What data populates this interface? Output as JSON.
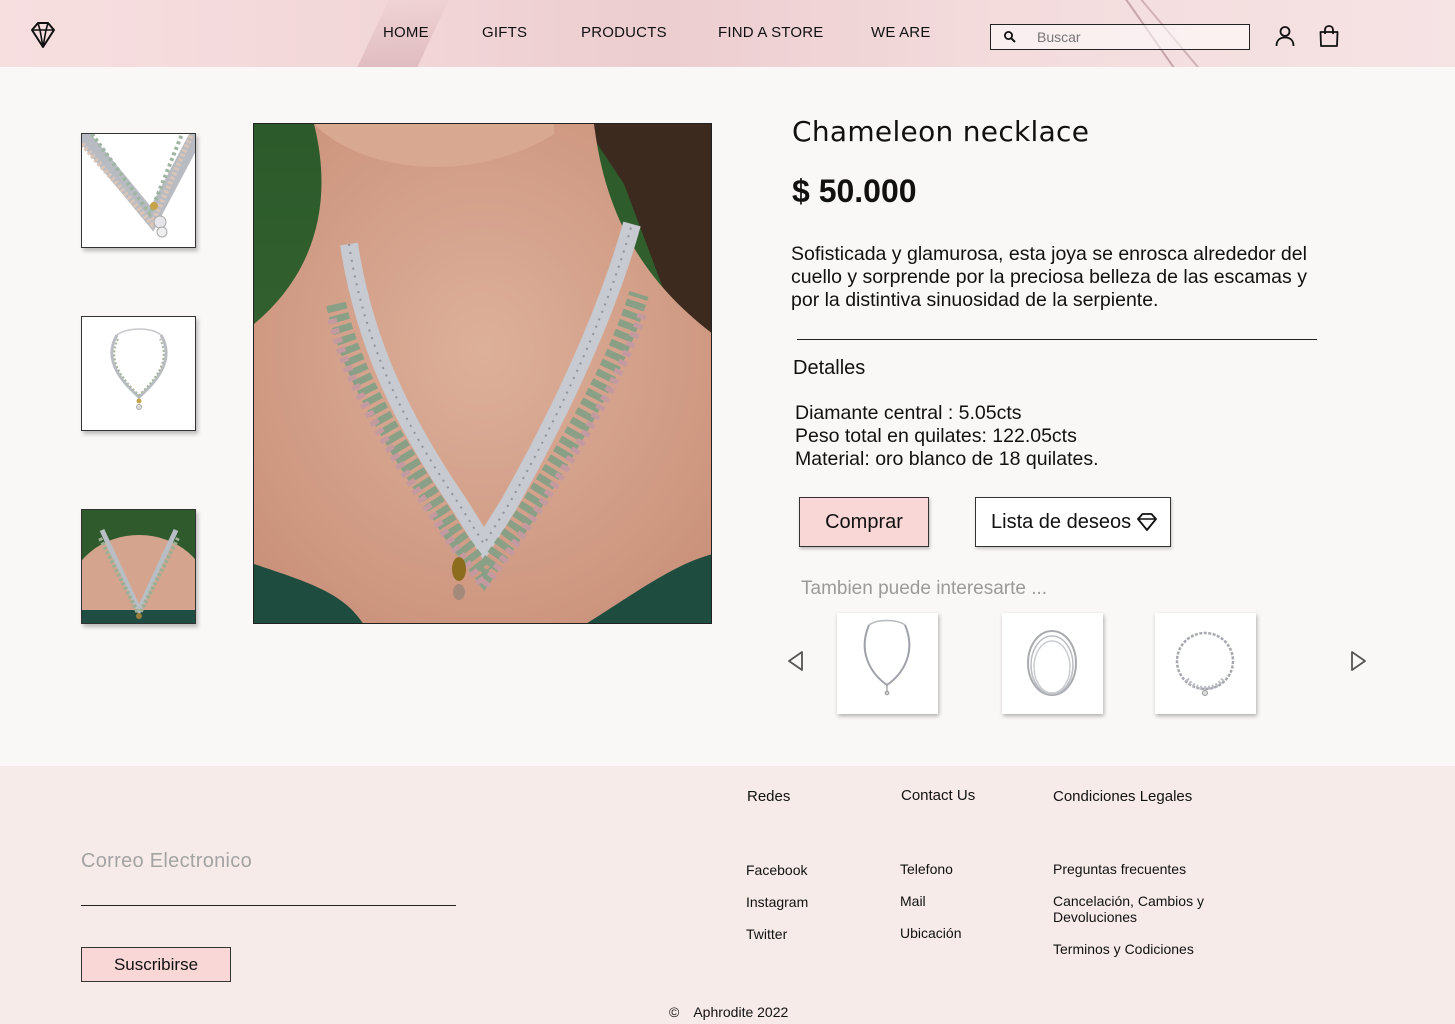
{
  "nav": {
    "items": [
      {
        "label": "HOME"
      },
      {
        "label": "GIFTS"
      },
      {
        "label": "PRODUCTS"
      },
      {
        "label": "FIND A STORE"
      },
      {
        "label": "WE ARE"
      }
    ],
    "search_placeholder": "Buscar",
    "icons": [
      "diamond-logo-icon",
      "search-icon",
      "user-icon",
      "shopping-bag-icon"
    ]
  },
  "product": {
    "title": "Chameleon necklace",
    "price": "$ 50.000",
    "description": "Sofisticada y glamurosa, esta joya se enrosca alrededor del cuello y sorprende por la preciosa belleza de las escamas y por la distintiva sinuosidad de la serpiente.",
    "details_heading": "Detalles",
    "details": [
      "Diamante central : 5.05cts",
      "Peso total en quilates: 122.05cts",
      "Material: oro blanco de 18 quilates."
    ],
    "buy_label": "Comprar",
    "wishlist_label": "Lista de deseos"
  },
  "recommendations": {
    "heading": "Tambien puede interesarte ...",
    "icons": [
      "arrow-left-icon",
      "arrow-right-icon"
    ]
  },
  "footer": {
    "email_placeholder": "Correo Electronico",
    "subscribe_label": "Suscribirse",
    "columns": [
      {
        "heading": "Redes",
        "links": [
          "Facebook",
          "Instagram",
          "Twitter"
        ]
      },
      {
        "heading": "Contact Us",
        "links": [
          "Telefono",
          "Mail",
          "Ubicación"
        ]
      },
      {
        "heading": "Condiciones Legales",
        "links": [
          "Preguntas frecuentes",
          "Cancelación, Cambios y Devoluciones",
          "Terminos y Codiciones"
        ]
      }
    ],
    "copyright_symbol": "©",
    "copyright": "Aphrodite 2022"
  },
  "colors": {
    "accent_pink": "#f9d7d6",
    "header_bg": "#f2d6d8",
    "footer_bg": "#f7ebea",
    "page_bg": "#faf8f7"
  }
}
